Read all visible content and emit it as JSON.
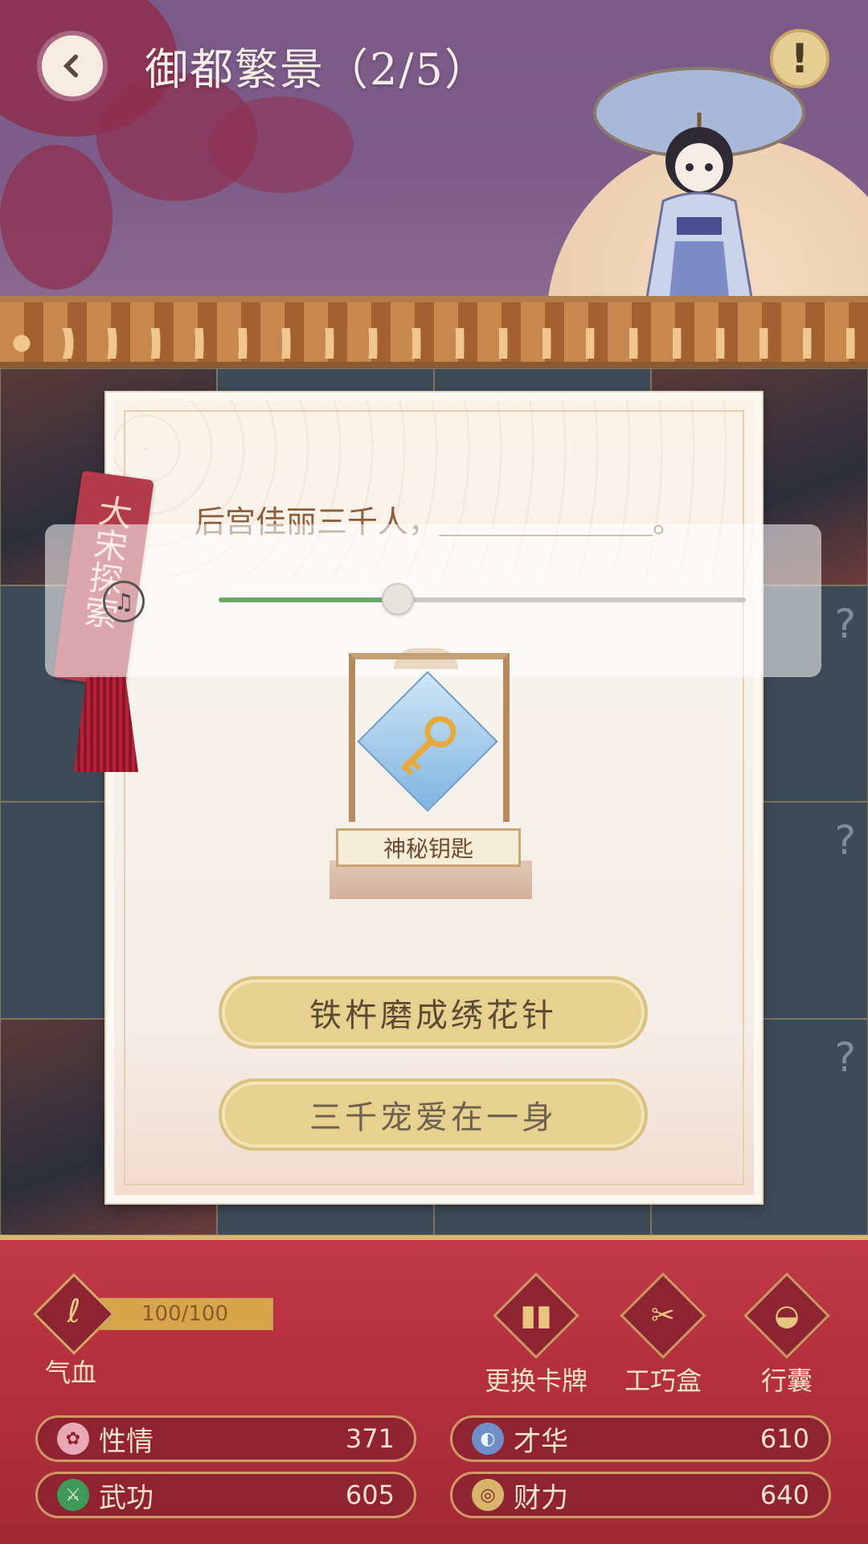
{
  "header": {
    "title": "御都繁景（2/5）"
  },
  "board": {
    "hidden_mark": "?"
  },
  "tag": {
    "label": "大宋探索"
  },
  "dialog": {
    "question": "后宫佳丽三千人，＿＿＿＿＿＿＿。",
    "music_progress": 0.34,
    "reward_label": "神秘钥匙",
    "answers": [
      "铁杵磨成绣花针",
      "三千宠爱在一身"
    ]
  },
  "status": {
    "hp_value": "100/100",
    "hp_label": "气血",
    "hp_fraction": 1.0
  },
  "tools": [
    {
      "label": "更换卡牌",
      "icon": "cards-icon"
    },
    {
      "label": "工巧盒",
      "icon": "scissors-icon"
    },
    {
      "label": "行囊",
      "icon": "bag-icon"
    }
  ],
  "stats": [
    {
      "name": "性情",
      "value": "371",
      "icon": "flower-icon"
    },
    {
      "name": "才华",
      "value": "610",
      "icon": "fan-icon"
    },
    {
      "name": "武功",
      "value": "605",
      "icon": "sword-icon"
    },
    {
      "name": "财力",
      "value": "640",
      "icon": "coin-icon"
    }
  ],
  "colors": {
    "accent_red": "#b5303d",
    "gold": "#e6d18f",
    "progress_green": "#6aa86a"
  }
}
